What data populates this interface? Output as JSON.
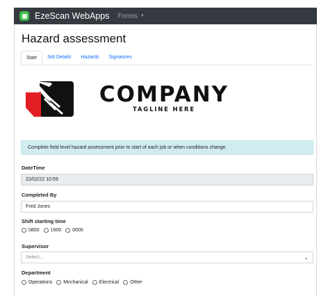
{
  "app": {
    "brand": "EzeScan WebApps",
    "nav_forms": "Forms",
    "brand_color": "#3fbf4a",
    "navbar_color": "#343a40"
  },
  "page": {
    "title": "Hazard assessment"
  },
  "tabs": [
    {
      "label": "Start",
      "active": true
    },
    {
      "label": "Job Details",
      "active": false
    },
    {
      "label": "Hazards",
      "active": false
    },
    {
      "label": "Signatures",
      "active": false
    }
  ],
  "logo": {
    "company": "COMPANY",
    "tagline": "TAGLINE HERE"
  },
  "alert": {
    "text": "Complete field level hazard assessment prior to start of each job or when conditions change.",
    "color": "#d1ecf1"
  },
  "form": {
    "datetime": {
      "label": "DateTime",
      "value": "22/02/22 10:59"
    },
    "completed_by": {
      "label": "Completed By",
      "value": "Fred Jones"
    },
    "shift": {
      "label": "Shift starting time",
      "options": [
        "0800",
        "1600",
        "0000"
      ]
    },
    "supervisor": {
      "label": "Supervisor",
      "placeholder": "Select..."
    },
    "department": {
      "label": "Department",
      "options": [
        "Operations",
        "Mechanical",
        "Electrical",
        "Other"
      ]
    }
  }
}
